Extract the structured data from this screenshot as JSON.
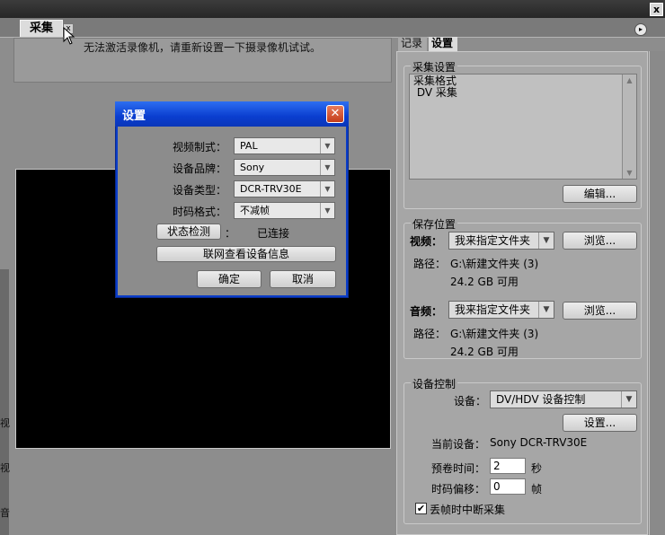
{
  "window": {
    "close_glyph": "x"
  },
  "capture_tab": {
    "label": "采集",
    "close_glyph": "x",
    "menu_glyph": "▸"
  },
  "message": "无法激活录像机，请重新设置一下摄录像机试试。",
  "right_tabs": [
    "记录",
    "设置"
  ],
  "capture_settings": {
    "group_label": "采集设置",
    "format_lines": [
      "采集格式",
      " DV 采集"
    ],
    "edit_button": "编辑..."
  },
  "save_location": {
    "group_label": "保存位置",
    "video_label": "视频：",
    "video_select": "我来指定文件夹",
    "video_browse": "浏览...",
    "video_path_label": "路径：",
    "video_path": "G:\\新建文件夹 (3)",
    "video_free": "24.2 GB 可用",
    "audio_label": "音频：",
    "audio_select": "我来指定文件夹",
    "audio_browse": "浏览...",
    "audio_path_label": "路径：",
    "audio_path": "G:\\新建文件夹 (3)",
    "audio_free": "24.2 GB 可用"
  },
  "device_control": {
    "group_label": "设备控制",
    "device_label": "设备：",
    "device_select": "DV/HDV 设备控制",
    "settings_button": "设置...",
    "current_device_label": "当前设备：",
    "current_device": "Sony DCR-TRV30E",
    "preroll_label": "预卷时间：",
    "preroll_value": "2",
    "preroll_unit": "秒",
    "timecode_offset_label": "时码偏移：",
    "timecode_offset_value": "0",
    "timecode_offset_unit": "帧",
    "abort_checkbox_label": "丢帧时中断采集",
    "abort_checked": "✔"
  },
  "dialog": {
    "title": "设置",
    "close_glyph": "✕",
    "video_standard_label": "视频制式：",
    "video_standard": "PAL",
    "brand_label": "设备品牌：",
    "brand": "Sony",
    "type_label": "设备类型：",
    "type": "DCR-TRV30E",
    "timecode_label": "时码格式：",
    "timecode": "不减帧",
    "status_button": "状态检测",
    "status_sep": "：",
    "status_value": "已连接",
    "online_button": "联网查看设备信息",
    "ok_button": "确定",
    "cancel_button": "取消"
  },
  "left_edge_glyphs": [
    "视",
    "视",
    "音"
  ],
  "colors": {
    "dialog_title": "#0a3ec8",
    "panel_bg": "#8d8d8d",
    "preview": "#000000"
  }
}
